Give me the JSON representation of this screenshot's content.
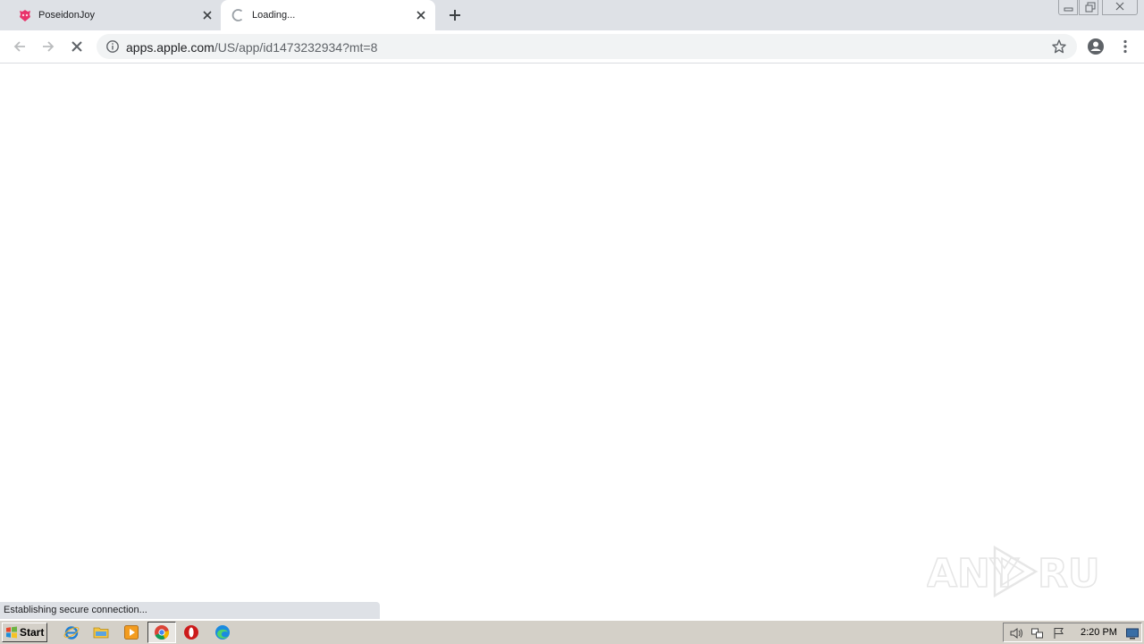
{
  "browser": {
    "tabs": [
      {
        "title": "PoseidonJoy",
        "favicon": "poseidonjoy-favicon",
        "active": false
      },
      {
        "title": "Loading...",
        "favicon": "loading-spinner-icon",
        "active": true
      }
    ],
    "address": {
      "host": "apps.apple.com",
      "path": "/US/app/id1473232934?mt=8"
    },
    "status_text": "Establishing secure connection..."
  },
  "watermark": {
    "text_left": "ANY",
    "text_right": "RUN"
  },
  "taskbar": {
    "start_label": "Start",
    "quick_launch": [
      "internet-explorer-icon",
      "file-explorer-icon",
      "media-player-icon",
      "chrome-icon",
      "opera-icon",
      "edge-icon"
    ],
    "tray_icons": [
      "volume-icon",
      "network-icon",
      "action-center-flag-icon",
      "show-desktop-icon"
    ],
    "clock": "2:20 PM"
  },
  "colors": {
    "tabstrip": "#dee1e6",
    "omnibox": "#f1f3f4",
    "taskbar": "#d4d0c8"
  }
}
